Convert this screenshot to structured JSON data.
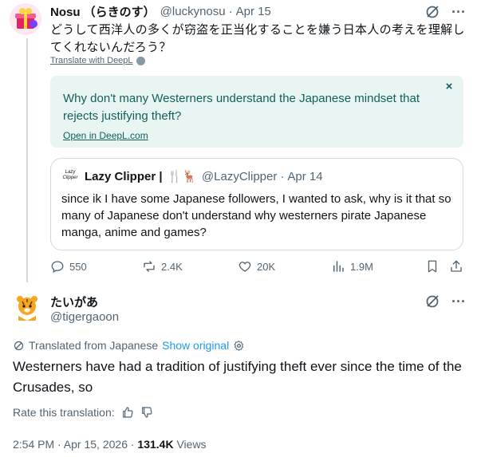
{
  "tweet": {
    "author_name": "Nosu （らきのす）",
    "author_handle": "@luckynosu",
    "separator": "·",
    "date": "Apr 15",
    "text": "どうして西洋人の多くが窃盗を正当化することを嫌う日本人の考えを理解してくれないんだろう？",
    "translate_link": "Translate with DeepL",
    "deepl": {
      "translation": "Why don't many Westerners understand the Japanese mindset that rejects justifying theft?",
      "open_link": "Open in DeepL.com",
      "close_symbol": "×"
    },
    "quote": {
      "avatar_text": "Lazy Clipper",
      "name": "Lazy Clipper |",
      "emojis": "🍴🦌",
      "handle": "@LazyClipper",
      "separator": "·",
      "date": "Apr 14",
      "text": "since ik I have some Japanese followers, I wanted to ask, why is it that so many of Japanese don't understand why westerners pirate Japanese manga, anime and games?"
    },
    "actions": {
      "replies": "550",
      "reposts": "2.4K",
      "likes": "20K",
      "views": "1.9M"
    }
  },
  "reply": {
    "author_name": "たいがあ",
    "author_handle": "@tigergaoon",
    "translated_from": "Translated from Japanese",
    "show_original": "Show original",
    "text": "Westerners have had a tradition of justifying theft ever since the time of the Crusades, so",
    "rate_label": "Rate this translation:",
    "timestamp": "2:54 PM · Apr 15, 2026 ·",
    "views_count": "131.4K",
    "views_label": "Views"
  },
  "colors": {
    "text_primary": "#0f1419",
    "text_secondary": "#536471",
    "link_blue": "#1d9bf0",
    "deepl_bg": "#e8f5f3",
    "deepl_text": "#13615a",
    "border": "#cfd9de"
  },
  "icons": [
    "grok-icon",
    "more-icon",
    "deepl-icon",
    "close-icon",
    "reply-icon",
    "repost-icon",
    "like-icon",
    "views-icon",
    "bookmark-icon",
    "share-icon",
    "translate-icon",
    "settings-icon",
    "thumbs-up-icon",
    "thumbs-down-icon"
  ]
}
